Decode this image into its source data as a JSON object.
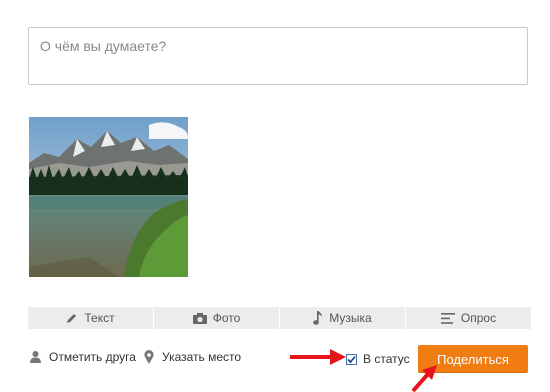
{
  "composer": {
    "placeholder": "О чём вы думаете?"
  },
  "tabs": [
    {
      "label": "Текст",
      "icon": "pencil-icon"
    },
    {
      "label": "Фото",
      "icon": "camera-icon"
    },
    {
      "label": "Музыка",
      "icon": "music-note-icon"
    },
    {
      "label": "Опрос",
      "icon": "poll-icon"
    }
  ],
  "actions": {
    "tag_friend": "Отметить друга",
    "tag_friend_icon": "person-icon",
    "location": "Указать место",
    "location_icon": "map-pin-icon"
  },
  "status": {
    "label": "В статус",
    "checked": true
  },
  "share_button": "Поделиться",
  "colors": {
    "accent": "#f07c12",
    "annotation_arrow": "#e8141b",
    "tab_bar": "#ececec"
  }
}
